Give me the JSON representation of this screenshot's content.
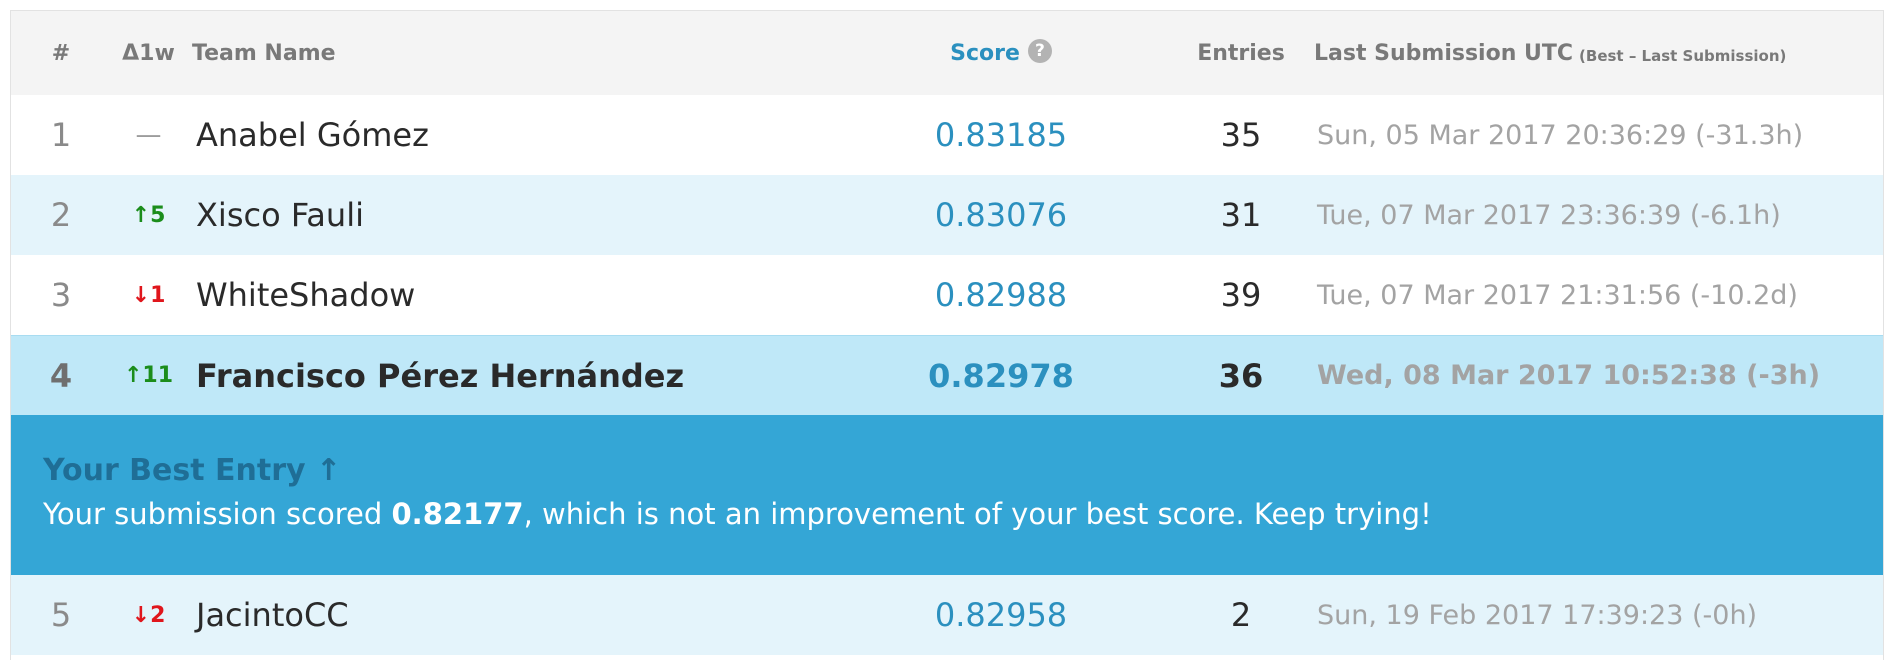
{
  "header": {
    "rank": "#",
    "delta": "Δ1w",
    "team": "Team Name",
    "score": "Score",
    "score_help_icon": "question-circle",
    "entries": "Entries",
    "last": "Last Submission UTC",
    "last_note": "(Best – Last Submission)"
  },
  "rows": [
    {
      "rank": "1",
      "delta": "—",
      "delta_dir": "same",
      "team": "Anabel Gómez",
      "score": "0.83185",
      "entries": "35",
      "last": "Sun, 05 Mar 2017 20:36:29 (-31.3h)"
    },
    {
      "rank": "2",
      "delta": "5",
      "delta_dir": "up",
      "team": "Xisco Fauli",
      "score": "0.83076",
      "entries": "31",
      "last": "Tue, 07 Mar 2017 23:36:39 (-6.1h)"
    },
    {
      "rank": "3",
      "delta": "1",
      "delta_dir": "down",
      "team": "WhiteShadow",
      "score": "0.82988",
      "entries": "39",
      "last": "Tue, 07 Mar 2017 21:31:56 (-10.2d)"
    },
    {
      "rank": "4",
      "delta": "11",
      "delta_dir": "up",
      "team": "Francisco Pérez Hernández",
      "score": "0.82978",
      "entries": "36",
      "last": "Wed, 08 Mar 2017 10:52:38 (-3h)"
    },
    {
      "rank": "5",
      "delta": "2",
      "delta_dir": "down",
      "team": "JacintoCC",
      "score": "0.82958",
      "entries": "2",
      "last": "Sun, 19 Feb 2017 17:39:23 (-0h)"
    }
  ],
  "banner": {
    "title": "Your Best Entry ↑",
    "msg_prefix": "Your submission scored ",
    "msg_score": "0.82177",
    "msg_suffix": ", which is not an improvement of your best score. Keep trying!"
  },
  "arrows": {
    "up": "↑",
    "down": "↓"
  },
  "colors": {
    "accent": "#2b90bf",
    "banner": "#34a6d6",
    "up": "#1b8d1b",
    "down": "#e0161c"
  }
}
